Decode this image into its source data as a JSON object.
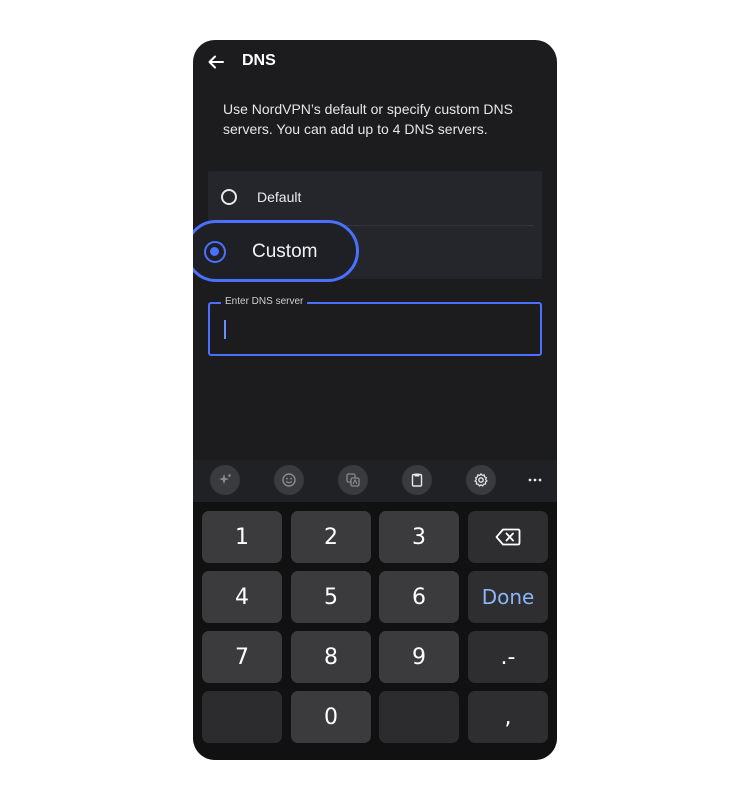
{
  "header": {
    "title": "DNS",
    "back_icon": "arrow-left-icon"
  },
  "description": "Use NordVPN’s default or specify custom DNS servers. You can add up to 4 DNS servers.",
  "options": [
    {
      "label": "Default",
      "selected": false
    },
    {
      "label": "Custom",
      "selected": true
    }
  ],
  "dns_field": {
    "label": "Enter DNS server",
    "value": ""
  },
  "keyboard_toolbar": {
    "icons": [
      "sparkle-icon",
      "emoji-icon",
      "translate-icon",
      "clipboard-icon",
      "settings-gear-icon",
      "more-dots-icon"
    ],
    "more_label": "···"
  },
  "keypad": {
    "keys": [
      "1",
      "2",
      "3",
      "4",
      "5",
      "6",
      "7",
      "8",
      "9",
      "0"
    ],
    "done": "Done",
    "dot_dash": ".-",
    "comma": ","
  },
  "colors": {
    "accent": "#4b6fff",
    "background": "#1c1c1e",
    "done_text": "#8ab4f8"
  }
}
